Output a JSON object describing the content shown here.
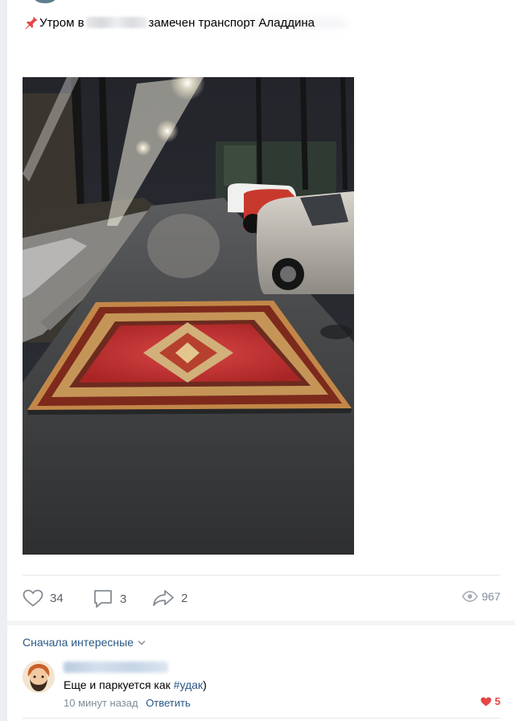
{
  "post": {
    "text_prefix": "Утром в",
    "text_suffix": "замечен транспорт Аладдина"
  },
  "actions": {
    "likes": "34",
    "comments": "3",
    "shares": "2",
    "views": "967"
  },
  "comments_section": {
    "sort_label": "Сначала интересные"
  },
  "comment": {
    "text_before": "Еще и паркуется как ",
    "hashtag": "#удак",
    "text_after": ")",
    "time": "10 минут назад",
    "reply_label": "Ответить",
    "likes": "5"
  },
  "colors": {
    "link": "#2a5885",
    "muted": "#818c99",
    "liked": "#e64646",
    "pin": "#e64646"
  },
  "icons": [
    "pin-icon",
    "heart-icon",
    "comment-icon",
    "share-icon",
    "eye-icon",
    "chevron-down-icon",
    "liked-heart-icon"
  ]
}
